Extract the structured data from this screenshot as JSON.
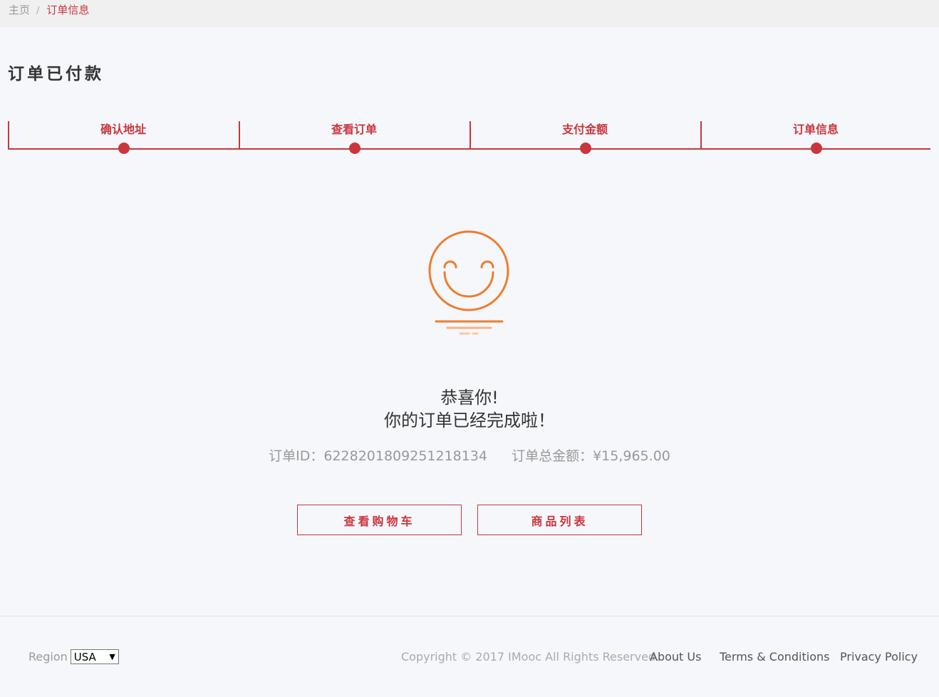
{
  "breadcrumb": {
    "home": "主页",
    "separator": "/",
    "current": "订单信息"
  },
  "title": "订单已付款",
  "steps": [
    {
      "label": "确认地址"
    },
    {
      "label": "查看订单"
    },
    {
      "label": "支付金额"
    },
    {
      "label": "订单信息"
    }
  ],
  "message": {
    "line1": "恭喜你!",
    "line2": "你的订单已经完成啦！"
  },
  "order": {
    "id_label": "订单ID：6228201809251218134",
    "total_label": "订单总金额：¥15,965.00"
  },
  "buttons": {
    "cart": "查看购物车",
    "list": "商品列表"
  },
  "footer": {
    "region_label": "Region",
    "region_value": "USA",
    "copyright": "Copyright © 2017 IMooc All Rights Reserved.",
    "links": [
      "About Us",
      "Terms & Conditions",
      "Privacy Policy"
    ]
  },
  "colors": {
    "accent": "#c9363d",
    "smiley": "#ee7d2c",
    "background": "#f6f7fb"
  },
  "icons": {
    "success": "smiley-face-icon",
    "dropdown": "chevron-down-icon"
  }
}
